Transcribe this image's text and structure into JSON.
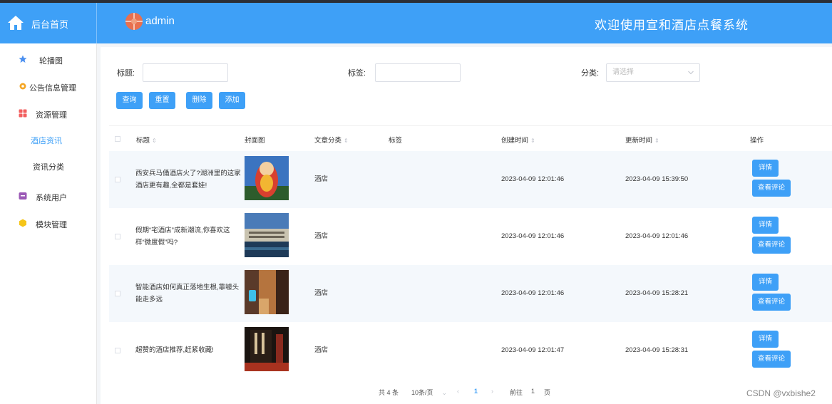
{
  "header": {
    "home_label": "后台首页",
    "user": "admin",
    "system_title": "欢迎使用宣和酒店点餐系统"
  },
  "sidebar": {
    "items": [
      {
        "label": "轮播图",
        "icon": "star-icon",
        "color": "#4a8ff0"
      },
      {
        "label": "公告信息管理",
        "icon": "gear-icon",
        "color": "#f5a623"
      },
      {
        "label": "资源管理",
        "icon": "grid-icon",
        "color": "#f25e5e"
      },
      {
        "label": "系统用户",
        "icon": "user-box-icon",
        "color": "#9b59b6"
      },
      {
        "label": "模块管理",
        "icon": "hexagon-icon",
        "color": "#f5c518"
      }
    ],
    "sub_items": [
      {
        "label": "酒店资讯",
        "active": true
      },
      {
        "label": "资讯分类",
        "active": false
      }
    ]
  },
  "filters": {
    "title_label": "标题:",
    "tag_label": "标签:",
    "category_label": "分类:",
    "category_placeholder": "请选择"
  },
  "buttons": {
    "query": "查询",
    "reset": "重置",
    "delete": "删除",
    "add": "添加"
  },
  "table": {
    "headers": {
      "title": "标题",
      "cover": "封面图",
      "category": "文章分类",
      "tags": "标签",
      "created": "创建时间",
      "updated": "更新时间",
      "actions": "操作"
    },
    "rows": [
      {
        "title_l1": "西安兵马俑酒店火了?湖洲里的这家",
        "title_l2": "酒店更有趣,全都是套娃!",
        "category": "酒店",
        "created": "2023-04-09 12:01:46",
        "updated": "2023-04-09 15:39:50"
      },
      {
        "title_l1": "假期“宅酒店”成新潮流,你喜欢这",
        "title_l2": "样“微度假”吗?",
        "category": "酒店",
        "created": "2023-04-09 12:01:46",
        "updated": "2023-04-09 12:01:46"
      },
      {
        "title_l1": "智能酒店如何真正落地生根,靠噱头",
        "title_l2": "能走多远",
        "category": "酒店",
        "created": "2023-04-09 12:01:46",
        "updated": "2023-04-09 15:28:21"
      },
      {
        "title_l1": "超赞的酒店推荐,赶紧收藏!",
        "title_l2": "",
        "category": "酒店",
        "created": "2023-04-09 12:01:47",
        "updated": "2023-04-09 15:28:31"
      }
    ],
    "detail_label": "详情",
    "comment_label": "查看评论"
  },
  "pagination": {
    "total": "共 4 条",
    "page_size": "10条/页",
    "current_page": "1",
    "goto_label": "前往",
    "goto_value": "1",
    "page_suffix": "页"
  },
  "watermark": "CSDN @vxbishe2",
  "colors": {
    "primary": "#3ea0f7",
    "row_alt": "#f4f8fc"
  }
}
